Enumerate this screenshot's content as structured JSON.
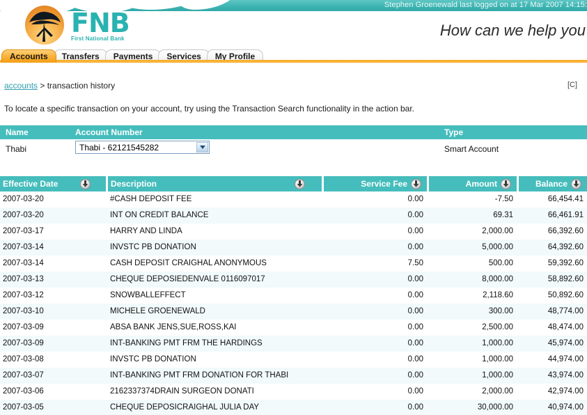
{
  "topbar": {
    "login_text": "Stephen Groenewald last logged on at 17 Mar 2007 14:15:"
  },
  "brand": {
    "name": "FNB",
    "subtitle": "First National Bank",
    "logo_icon": "acacia-tree-icon",
    "tagline": "How can we help you"
  },
  "tabs": [
    {
      "label": "Accounts",
      "active": true
    },
    {
      "label": "Transfers",
      "active": false
    },
    {
      "label": "Payments",
      "active": false
    },
    {
      "label": "Services",
      "active": false
    },
    {
      "label": "My Profile",
      "active": false
    }
  ],
  "breadcrumb": {
    "link": "accounts",
    "separator": " > ",
    "current": "transaction history"
  },
  "corner_tag": "[C]",
  "hint": "To locate a specific transaction on your account, try using the Transaction Search functionality in the action bar.",
  "account_table": {
    "headers": [
      "Name",
      "Account Number",
      "Type"
    ],
    "name": "Thabi",
    "account_select_value": "Thabi - 62121545282",
    "type": "Smart Account"
  },
  "transactions_table": {
    "headers": [
      {
        "label": "Effective Date",
        "sort_icon": "sort-down-icon"
      },
      {
        "label": "Description",
        "sort_icon": "sort-down-icon"
      },
      {
        "label": "Service Fee",
        "sort_icon": "sort-down-icon"
      },
      {
        "label": "Amount",
        "sort_icon": "sort-down-icon"
      },
      {
        "label": "Balance",
        "sort_icon": "sort-down-icon"
      }
    ],
    "rows": [
      {
        "date": "2007-03-20",
        "description": "#CASH DEPOSIT FEE",
        "fee": "0.00",
        "amount": "-7.50",
        "balance": "66,454.41"
      },
      {
        "date": "2007-03-20",
        "description": "INT ON CREDIT BALANCE",
        "fee": "0.00",
        "amount": "69.31",
        "balance": "66,461.91"
      },
      {
        "date": "2007-03-17",
        "description": "HARRY AND LINDA",
        "fee": "0.00",
        "amount": "2,000.00",
        "balance": "66,392.60"
      },
      {
        "date": "2007-03-14",
        "description": "INVSTC PB DONATION",
        "fee": "0.00",
        "amount": "5,000.00",
        "balance": "64,392.60"
      },
      {
        "date": "2007-03-14",
        "description": "CASH DEPOSIT CRAIGHAL ANONYMOUS",
        "fee": "7.50",
        "amount": "500.00",
        "balance": "59,392.60"
      },
      {
        "date": "2007-03-13",
        "description": "CHEQUE DEPOSIEDENVALE 0116097017",
        "fee": "0.00",
        "amount": "8,000.00",
        "balance": "58,892.60"
      },
      {
        "date": "2007-03-12",
        "description": "SNOWBALLEFFECT",
        "fee": "0.00",
        "amount": "2,118.60",
        "balance": "50,892.60"
      },
      {
        "date": "2007-03-10",
        "description": "MICHELE GROENEWALD",
        "fee": "0.00",
        "amount": "300.00",
        "balance": "48,774.00"
      },
      {
        "date": "2007-03-09",
        "description": "ABSA BANK JENS,SUE,ROSS,KAI",
        "fee": "0.00",
        "amount": "2,500.00",
        "balance": "48,474.00"
      },
      {
        "date": "2007-03-09",
        "description": "INT-BANKING PMT FRM THE HARDINGS",
        "fee": "0.00",
        "amount": "1,000.00",
        "balance": "45,974.00"
      },
      {
        "date": "2007-03-08",
        "description": "INVSTC PB DONATION",
        "fee": "0.00",
        "amount": "1,000.00",
        "balance": "44,974.00"
      },
      {
        "date": "2007-03-07",
        "description": "INT-BANKING PMT FRM DONATION FOR THABI",
        "fee": "0.00",
        "amount": "1,000.00",
        "balance": "43,974.00"
      },
      {
        "date": "2007-03-06",
        "description": "2162337374DRAIN SURGEON DONATI",
        "fee": "0.00",
        "amount": "2,000.00",
        "balance": "42,974.00"
      },
      {
        "date": "2007-03-05",
        "description": "CHEQUE DEPOSICRAIGHAL JULIA DAY",
        "fee": "0.00",
        "amount": "30,000.00",
        "balance": "40,974.00"
      }
    ]
  },
  "colors": {
    "teal": "#45bdbc",
    "teal_dark": "#30a9a7",
    "brand_teal": "#29b2b0",
    "orange": "#f7a81c",
    "tab_active": "#f9b53f",
    "row_alt": "#f2fafb",
    "link": "#2f9fae"
  }
}
